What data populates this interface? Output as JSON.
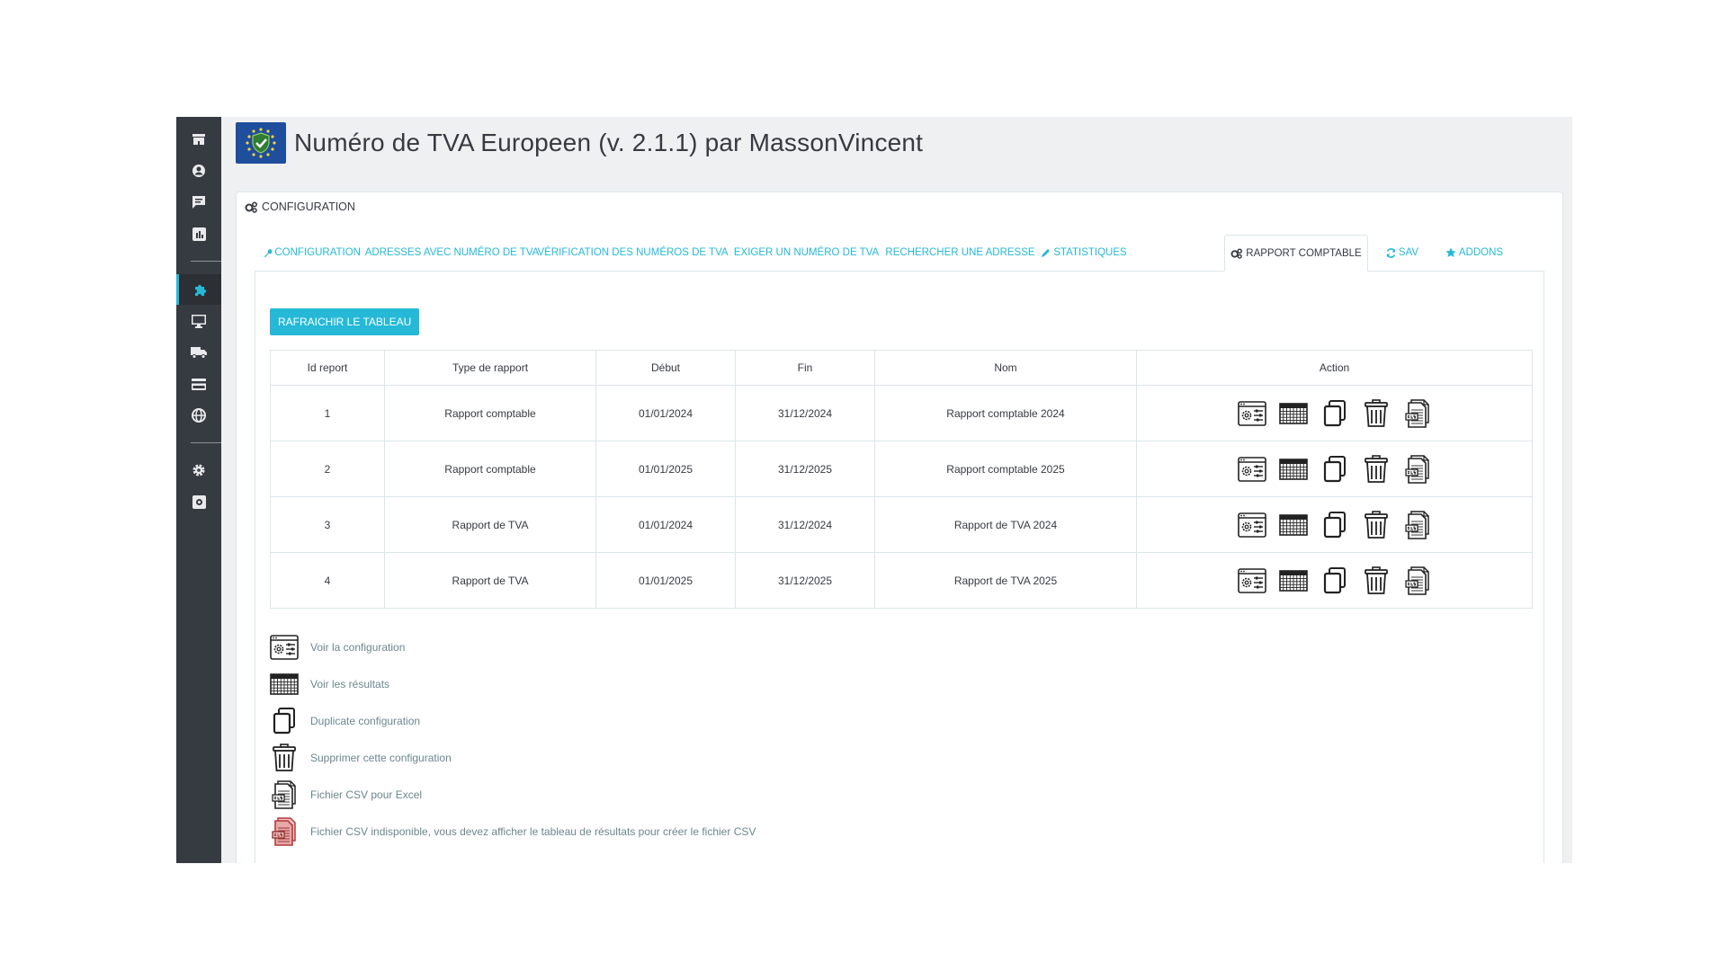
{
  "page": {
    "title": "Numéro de TVA Europeen (v. 2.1.1) par MassonVincent"
  },
  "sidebar": {
    "items": [
      {
        "icon": "store-icon"
      },
      {
        "icon": "user-icon"
      },
      {
        "icon": "chat-icon"
      },
      {
        "icon": "stats-icon"
      },
      {
        "icon": "puzzle-icon",
        "active": true
      },
      {
        "icon": "monitor-icon"
      },
      {
        "icon": "truck-icon"
      },
      {
        "icon": "card-icon"
      },
      {
        "icon": "globe-icon"
      },
      {
        "icon": "gear-icon"
      },
      {
        "icon": "settings-box-icon"
      }
    ]
  },
  "panel": {
    "heading": "CONFIGURATION"
  },
  "tabs": [
    {
      "label": "CONFIGURATION",
      "icon": "wrench-icon"
    },
    {
      "label": "ADRESSES AVEC NUMÉRO DE TVA",
      "icon": "database-icon"
    },
    {
      "label": "VÉRIFICATION DES NUMÉROS DE TVA",
      "icon": "check-icon"
    },
    {
      "label": "EXIGER UN NUMÉRO DE TVA",
      "icon": "search-icon"
    },
    {
      "label": "RECHERCHER UNE ADRESSE",
      "icon": "search-icon"
    },
    {
      "label": "STATISTIQUES",
      "icon": "pencil-icon"
    },
    {
      "label": "RAPPORT COMPTABLE",
      "icon": "cogs-icon",
      "active": true
    },
    {
      "label": "SAV",
      "icon": "refresh-icon"
    },
    {
      "label": "ADDONS",
      "icon": "star-icon"
    }
  ],
  "refresh_button": "RAFRAICHIR LE TABLEAU",
  "table": {
    "headers": [
      "Id report",
      "Type de rapport",
      "Début",
      "Fin",
      "Nom",
      "Action"
    ],
    "rows": [
      [
        "1",
        "Rapport comptable",
        "01/01/2024",
        "31/12/2024",
        "Rapport comptable 2024"
      ],
      [
        "2",
        "Rapport comptable",
        "01/01/2025",
        "31/12/2025",
        "Rapport comptable 2025"
      ],
      [
        "3",
        "Rapport de TVA",
        "01/01/2024",
        "31/12/2024",
        "Rapport de TVA 2024"
      ],
      [
        "4",
        "Rapport de TVA",
        "01/01/2025",
        "31/12/2025",
        "Rapport de TVA 2025"
      ]
    ],
    "actions": [
      "config-view-icon",
      "results-grid-icon",
      "duplicate-icon",
      "trash-icon",
      "csv-file-icon"
    ]
  },
  "legend": [
    {
      "icon": "config-view-icon",
      "text": "Voir la configuration"
    },
    {
      "icon": "results-grid-icon",
      "text": "Voir les résultats"
    },
    {
      "icon": "duplicate-icon",
      "text": "Duplicate configuration"
    },
    {
      "icon": "trash-icon",
      "text": "Supprimer cette configuration"
    },
    {
      "icon": "csv-file-icon",
      "text": "Fichier CSV pour Excel"
    },
    {
      "icon": "csv-unavailable-icon",
      "text": "Fichier CSV indisponible, vous devez afficher le tableau de résultats pour créer le fichier CSV"
    }
  ],
  "colors": {
    "accent": "#25b9d7",
    "sidebar": "#363a41",
    "background": "#eef0f2",
    "text": "#363a41"
  }
}
